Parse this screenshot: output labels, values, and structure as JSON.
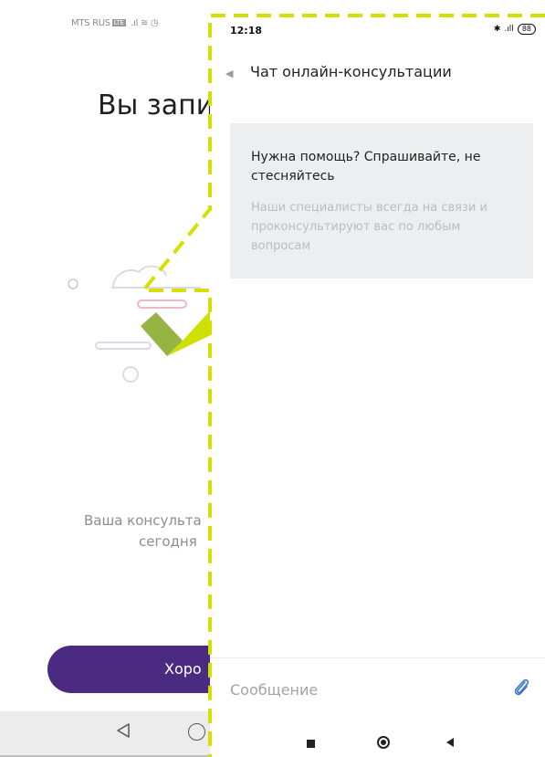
{
  "background_app": {
    "status_bar": {
      "carrier": "MTS RUS",
      "network_badge": "LTE"
    },
    "title": "Вы запи",
    "consultation_text_line1": "Ваша консульта",
    "consultation_text_line2": "сегодня",
    "button_label": "Хоро"
  },
  "chat_app": {
    "status_bar": {
      "time": "12:18",
      "battery": "88"
    },
    "header": {
      "title": "Чат онлайн-консультации"
    },
    "info_card": {
      "title": "Нужна помощь? Спрашивайте, не стесняйтесь",
      "text": "Наши специалисты всегда на связи и проконсультируют вас по любым вопросам"
    },
    "message_input": {
      "placeholder": "Сообщение",
      "value": ""
    }
  },
  "colors": {
    "callout_dash": "#d6e000",
    "button_purple": "#4b2a82",
    "card_background": "#edeeef",
    "attach_icon": "#3f7ac8"
  }
}
